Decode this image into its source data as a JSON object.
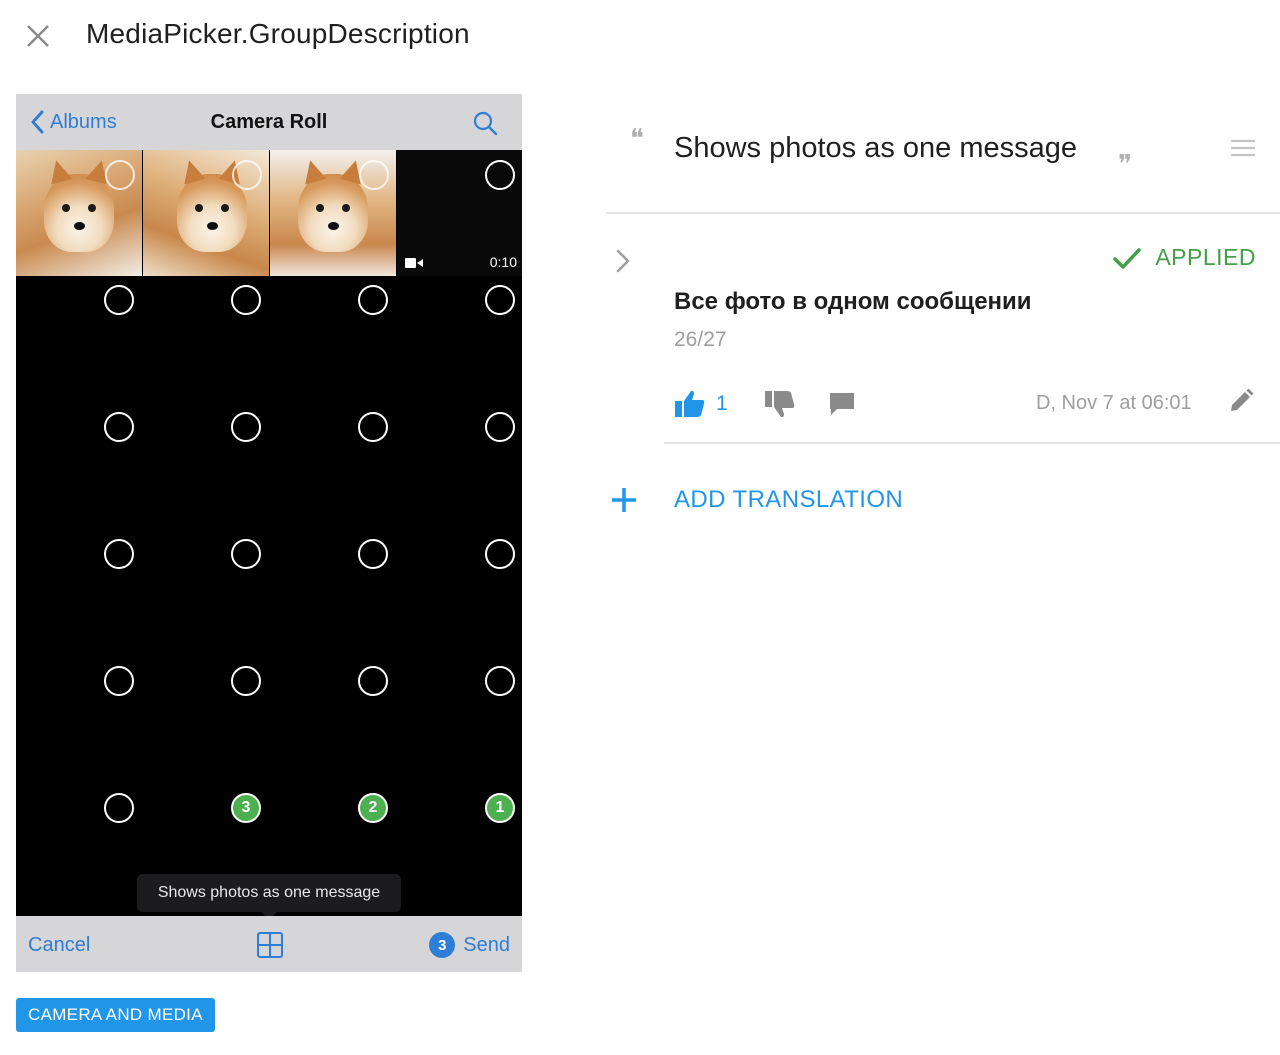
{
  "header": {
    "title": "MediaPicker.GroupDescription",
    "close_icon": "close-icon"
  },
  "phone": {
    "nav": {
      "back_label": "Albums",
      "title": "Camera Roll",
      "search_icon": "search-icon"
    },
    "video_duration": "0:10",
    "selected_badges": [
      "3",
      "2",
      "1"
    ],
    "tooltip": "Shows photos as one message",
    "bottom": {
      "cancel_label": "Cancel",
      "send_count": "3",
      "send_label": "Send"
    }
  },
  "tag_label": "CAMERA AND MEDIA",
  "source": {
    "text": "Shows photos as one message"
  },
  "translation": {
    "status": "APPLIED",
    "text": "Все фото в одном сообщении",
    "char_count": "26/27",
    "upvotes": "1",
    "meta": "D, Nov 7 at 06:01"
  },
  "add_translation_label": "ADD TRANSLATION",
  "colors": {
    "accent": "#2196e8",
    "applied": "#43a047",
    "ios_blue": "#2e7dd6",
    "selected_green": "#4caf50"
  }
}
